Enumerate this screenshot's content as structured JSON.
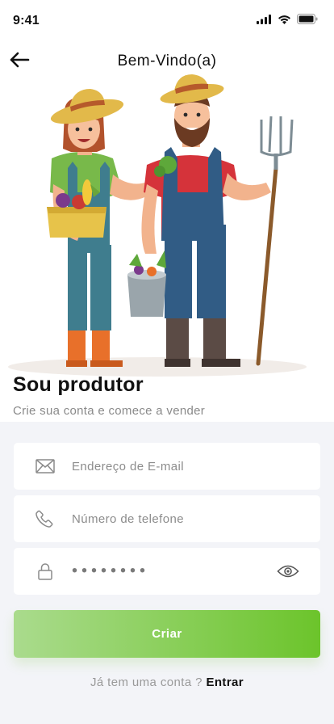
{
  "status_bar": {
    "time": "9:41",
    "icons": [
      "cellular-signal-icon",
      "wifi-icon",
      "battery-icon"
    ]
  },
  "header": {
    "back_icon": "arrow-left-icon",
    "title": "Bem-Vindo(a)"
  },
  "hero": {
    "illustration": "farmer-couple-illustration"
  },
  "intro": {
    "title": "Sou produtor",
    "subtitle": "Crie sua conta e comece a vender"
  },
  "form": {
    "email": {
      "icon": "envelope-icon",
      "placeholder": "Endereço de E-mail",
      "value": ""
    },
    "phone": {
      "icon": "phone-icon",
      "placeholder": "Número de telefone",
      "value": ""
    },
    "password": {
      "icon": "lock-icon",
      "masked_value": "••••••••",
      "toggle_icon": "eye-icon"
    },
    "submit_label": "Criar"
  },
  "footer": {
    "prompt": "Já tem uma conta ?",
    "link_label": "Entrar"
  },
  "colors": {
    "accent_start": "#aadb8d",
    "accent_end": "#6cc42b",
    "form_background": "#f3f4f8",
    "muted_text": "#8a8a8a"
  }
}
